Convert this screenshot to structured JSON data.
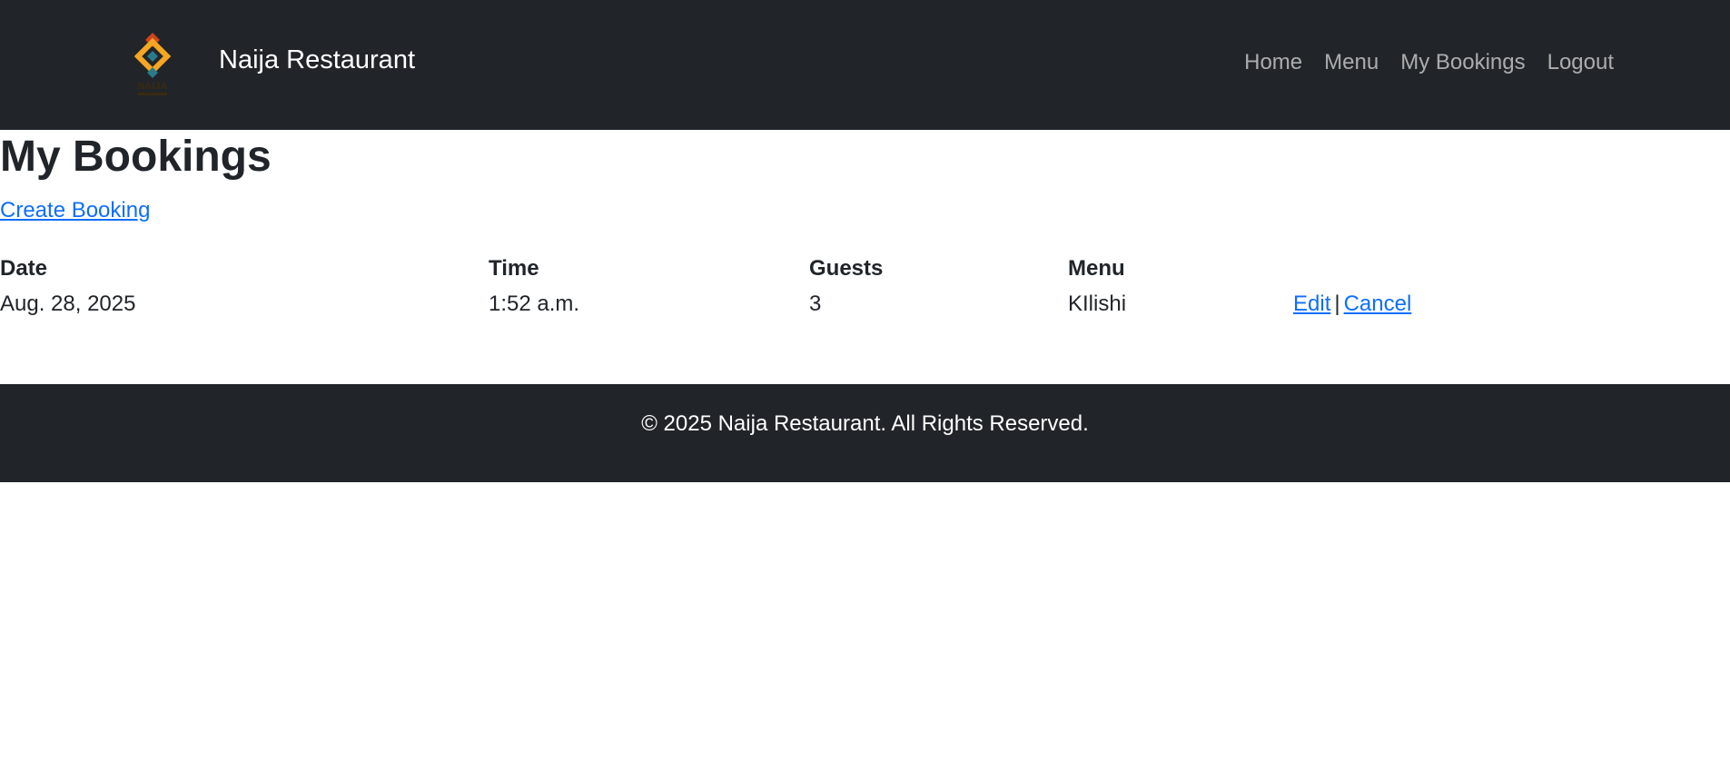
{
  "navbar": {
    "brand_name": "Naija Restaurant",
    "logo_icon": "naija-diamond-logo",
    "logo_text": "NAIJA",
    "links": [
      "Home",
      "Menu",
      "My Bookings",
      "Logout"
    ]
  },
  "page": {
    "title": "My Bookings",
    "create_link": "Create Booking"
  },
  "table": {
    "headers": [
      "Date",
      "Time",
      "Guests",
      "Menu",
      ""
    ],
    "rows": [
      {
        "date": "Aug. 28, 2025",
        "time": "1:52 a.m.",
        "guests": "3",
        "menu": "KIlishi",
        "edit_label": "Edit",
        "separator": "|",
        "cancel_label": "Cancel"
      }
    ]
  },
  "footer": {
    "text": "© 2025 Naija Restaurant. All Rights Reserved."
  },
  "colors": {
    "nav_bg": "#212529",
    "link": "#0d6efd",
    "logo_orange": "#f5a623",
    "logo_teal": "#2a7a8c",
    "logo_red": "#d0451b"
  }
}
